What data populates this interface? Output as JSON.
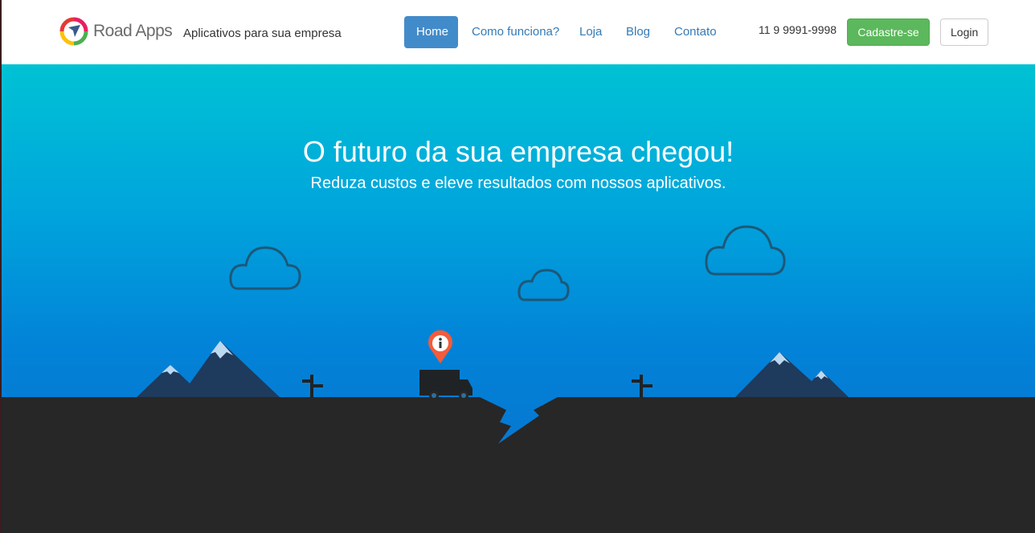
{
  "brand": {
    "name": "Road Apps",
    "tagline": "Aplicativos para sua empresa",
    "logo_icon": "compass-ring-logo"
  },
  "nav": {
    "items": [
      {
        "label": "Home",
        "active": true
      },
      {
        "label": "Como funciona?",
        "active": false
      },
      {
        "label": "Loja",
        "active": false
      },
      {
        "label": "Blog",
        "active": false
      },
      {
        "label": "Contato",
        "active": false
      }
    ]
  },
  "contact": {
    "phone": "11 9 9991-9998"
  },
  "actions": {
    "signup_label": "Cadastre-se",
    "login_label": "Login"
  },
  "hero": {
    "title": "O futuro da sua empresa chegou!",
    "subtitle": "Reduza custos e eleve resultados com nossos aplicativos."
  },
  "colors": {
    "primary": "#428bca",
    "success": "#5cb85c",
    "link": "#337ab7",
    "ground": "#272727",
    "pin": "#f25c3c"
  }
}
